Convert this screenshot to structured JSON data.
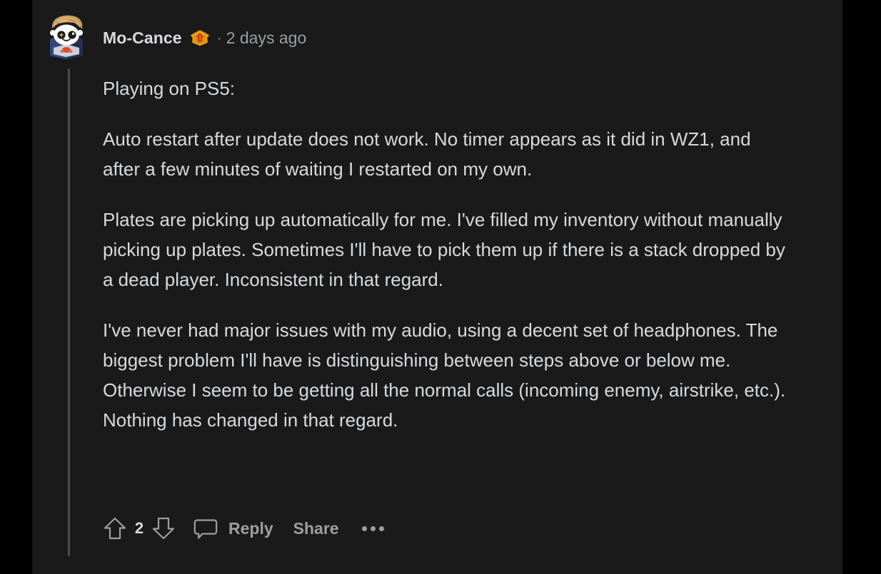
{
  "theme": {
    "page_background": "#000000",
    "content_background": "#1a1a1b",
    "primary_text": "#d7dadc",
    "muted_text": "#9b9fa1",
    "thread_line": "#4a4c4e",
    "badge_gold": "#f0a725",
    "badge_arrow_red": "#d93a00"
  },
  "comment": {
    "author": "Mo-Cance",
    "author_badge": "top-commenter-badge",
    "meta_separator": "·",
    "timestamp": "2 days ago",
    "avatar_alt": "snoo-avatar",
    "paragraphs": [
      "Playing on PS5:",
      "Auto restart after update does not work. No timer appears as it did in WZ1, and after a few minutes of waiting I restarted on my own.",
      "Plates are picking up automatically for me. I've filled my inventory without manually picking up plates. Sometimes I'll have to pick them up if there is a stack dropped by a dead player. Inconsistent in that regard.",
      "I've never had major issues with my audio, using a decent set of headphones. The biggest problem I'll have is distinguishing between steps above or below me. Otherwise I seem to be getting all the normal calls (incoming enemy, airstrike, etc.). Nothing has changed in that regard."
    ],
    "actions": {
      "upvote_icon": "upvote-arrow-icon",
      "score": "2",
      "downvote_icon": "downvote-arrow-icon",
      "comment_icon": "speech-bubble-icon",
      "reply_label": "Reply",
      "share_label": "Share",
      "more_label": "more-options"
    }
  }
}
